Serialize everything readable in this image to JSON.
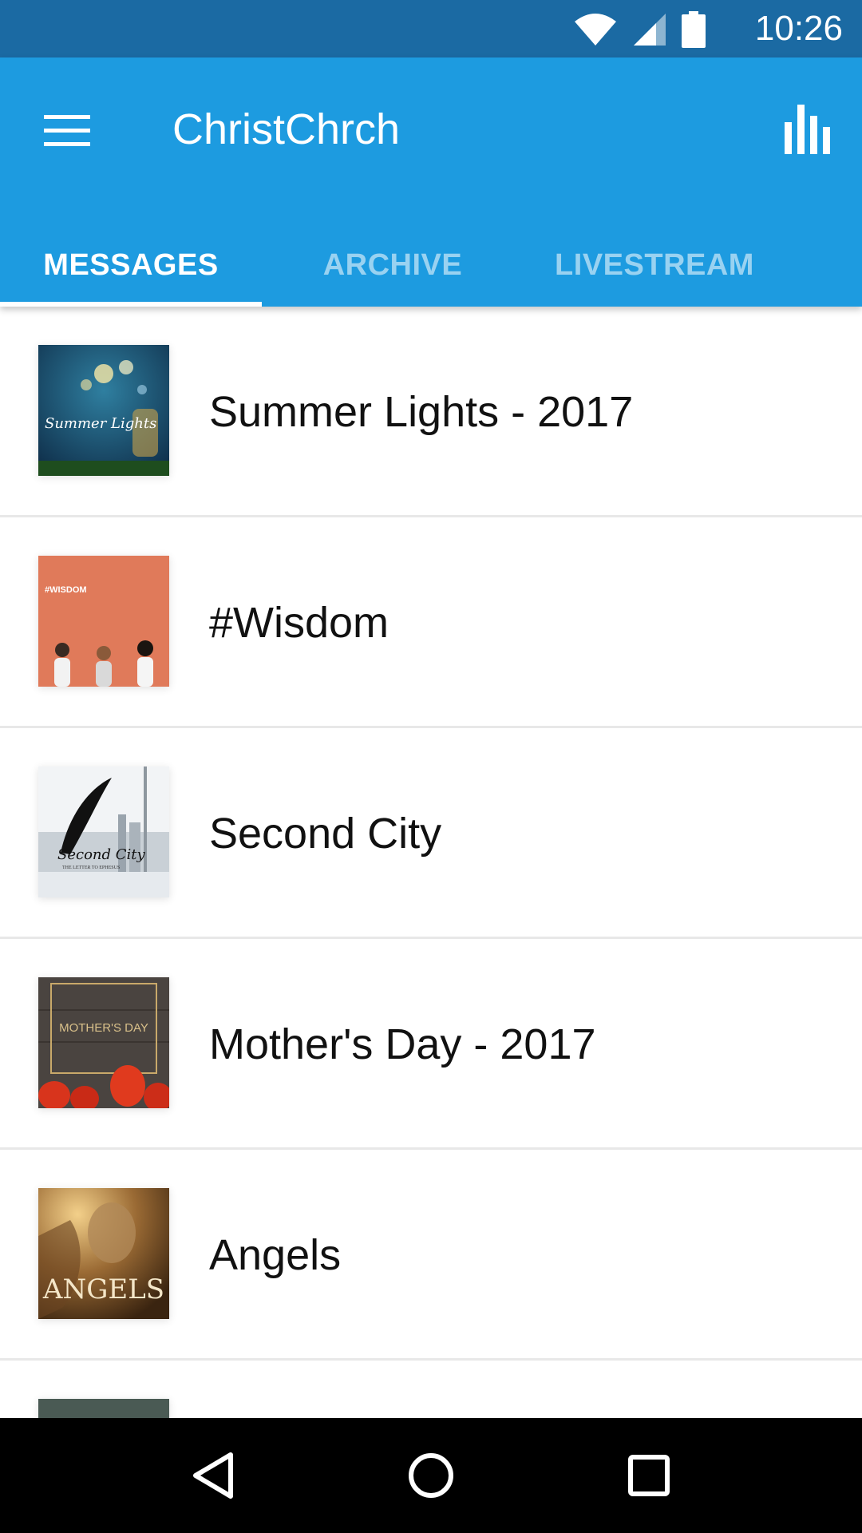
{
  "status_bar": {
    "time": "10:26",
    "icons": [
      "wifi-icon",
      "signal-icon",
      "battery-icon"
    ]
  },
  "app_bar": {
    "title": "ChristChrch",
    "menu_icon": "hamburger-menu-icon",
    "action_icon": "bar-chart-icon",
    "background_color": "#1d9be0"
  },
  "tabs": [
    {
      "label": "MESSAGES",
      "active": true
    },
    {
      "label": "ARCHIVE",
      "active": false
    },
    {
      "label": "LIVESTREAM",
      "active": false
    }
  ],
  "messages": [
    {
      "title": "Summer Lights - 2017",
      "thumb_text": "Summer Lights"
    },
    {
      "title": "#Wisdom",
      "thumb_text": "#WISDOM"
    },
    {
      "title": "Second City",
      "thumb_text": "Second City",
      "thumb_subtext": "THE LETTER TO EPHESUS"
    },
    {
      "title": "Mother's Day - 2017",
      "thumb_text": "MOTHER'S DAY"
    },
    {
      "title": "Angels",
      "thumb_text": "ANGELS"
    }
  ],
  "nav_bar": {
    "back_icon": "back-triangle-icon",
    "home_icon": "home-circle-icon",
    "recents_icon": "recents-square-icon"
  }
}
